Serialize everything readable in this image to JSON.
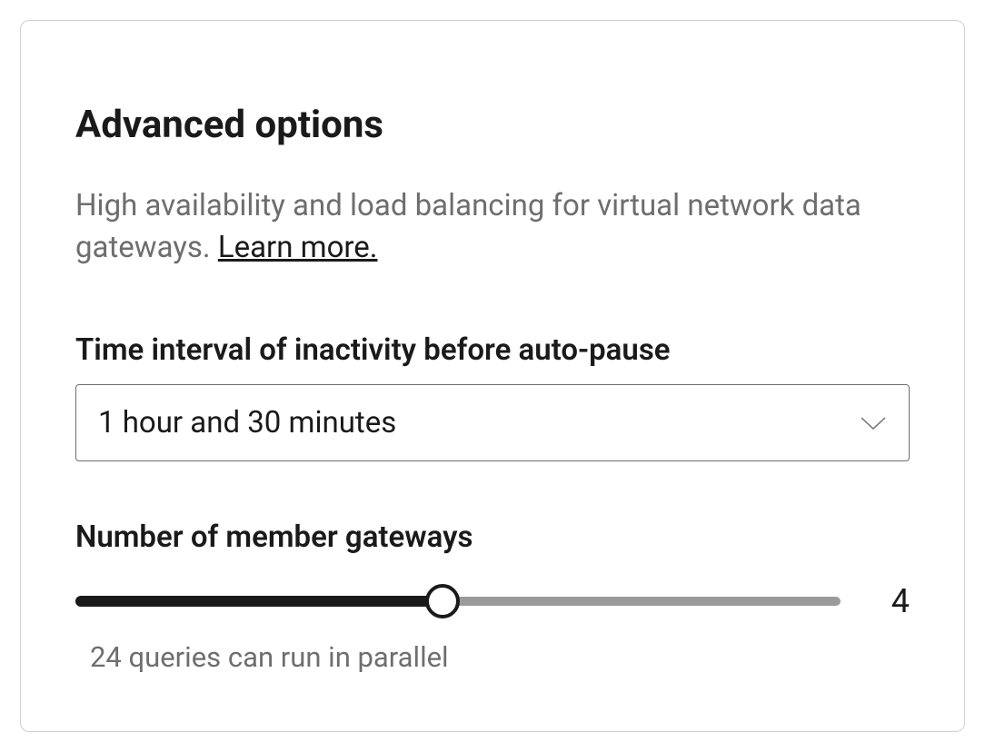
{
  "panel": {
    "heading": "Advanced options",
    "description_prefix": "High availability and load balancing for virtual network data gateways. ",
    "learn_more": "Learn more."
  },
  "autopause": {
    "label": "Time interval of inactivity before auto-pause",
    "selected": "1 hour and 30 minutes"
  },
  "gateways": {
    "label": "Number of member gateways",
    "value": "4",
    "fill_percent": 48,
    "helper": "24 queries can run in parallel"
  }
}
